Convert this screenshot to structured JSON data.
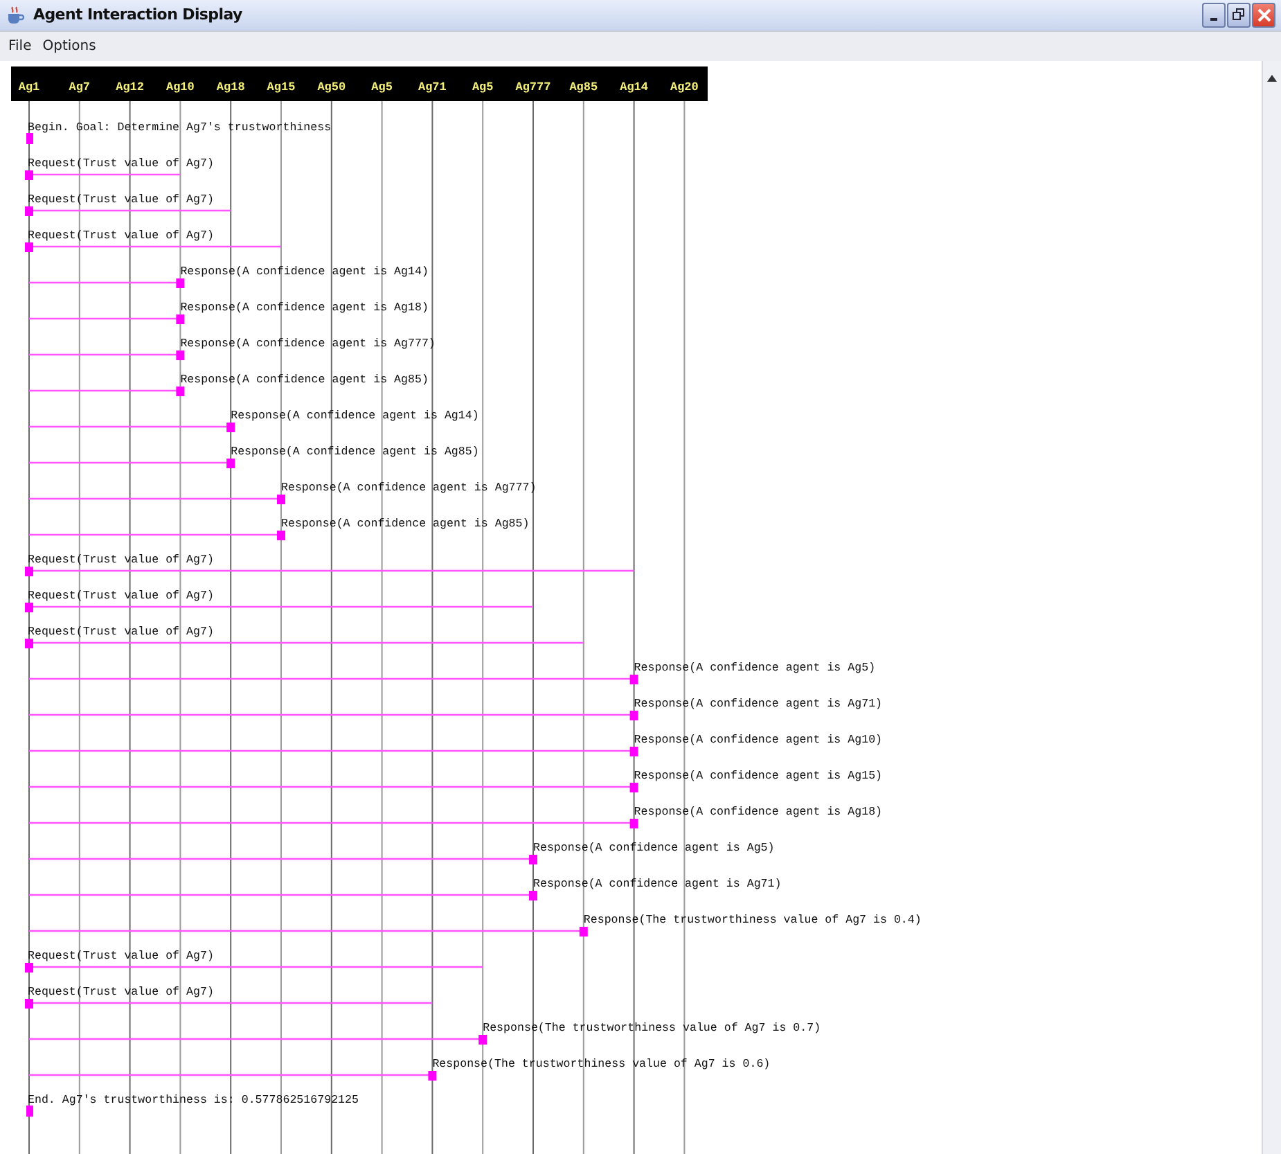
{
  "window": {
    "title": "Agent Interaction Display"
  },
  "menu": [
    "File",
    "Options"
  ],
  "agents": [
    "Ag1",
    "Ag7",
    "Ag12",
    "Ag10",
    "Ag18",
    "Ag15",
    "Ag50",
    "Ag5",
    "Ag71",
    "Ag5",
    "Ag777",
    "Ag85",
    "Ag14",
    "Ag20"
  ],
  "messages": [
    {
      "kind": "begin",
      "text": "Begin. Goal: Determine Ag7's trustworthiness"
    },
    {
      "kind": "request",
      "text": "Request(Trust value of Ag7)"
    },
    {
      "kind": "request",
      "text": "Request(Trust value of Ag7)"
    },
    {
      "kind": "request",
      "text": "Request(Trust value of Ag7)"
    },
    {
      "kind": "response",
      "text": "Response(A confidence agent is Ag14)"
    },
    {
      "kind": "response",
      "text": "Response(A confidence agent is Ag18)"
    },
    {
      "kind": "response",
      "text": "Response(A confidence agent is Ag777)"
    },
    {
      "kind": "response",
      "text": "Response(A confidence agent is Ag85)"
    },
    {
      "kind": "response",
      "text": "Response(A confidence agent is Ag14)"
    },
    {
      "kind": "response",
      "text": "Response(A confidence agent is Ag85)"
    },
    {
      "kind": "response",
      "text": "Response(A confidence agent is Ag777)"
    },
    {
      "kind": "response",
      "text": "Response(A confidence agent is Ag85)"
    },
    {
      "kind": "request",
      "text": "Request(Trust value of Ag7)"
    },
    {
      "kind": "request",
      "text": "Request(Trust value of Ag7)"
    },
    {
      "kind": "request",
      "text": "Request(Trust value of Ag7)"
    },
    {
      "kind": "response",
      "text": "Response(A confidence agent is Ag5)"
    },
    {
      "kind": "response",
      "text": "Response(A confidence agent is Ag71)"
    },
    {
      "kind": "response",
      "text": "Response(A confidence agent is Ag10)"
    },
    {
      "kind": "response",
      "text": "Response(A confidence agent is Ag15)"
    },
    {
      "kind": "response",
      "text": "Response(A confidence agent is Ag18)"
    },
    {
      "kind": "response",
      "text": "Response(A confidence agent is Ag5)"
    },
    {
      "kind": "response",
      "text": "Response(A confidence agent is Ag71)"
    },
    {
      "kind": "response",
      "text": "Response(The trustworthiness value of Ag7 is 0.4)"
    },
    {
      "kind": "request",
      "text": "Request(Trust value of Ag7)"
    },
    {
      "kind": "request",
      "text": "Request(Trust value of Ag7)"
    },
    {
      "kind": "response",
      "text": "Response(The trustworthiness value of Ag7 is 0.7)"
    },
    {
      "kind": "response",
      "text": "Response(The trustworthiness value of Ag7 is 0.6)"
    },
    {
      "kind": "end",
      "text": "End. Ag7's trustworthiness is: 0.577862516792125"
    }
  ]
}
